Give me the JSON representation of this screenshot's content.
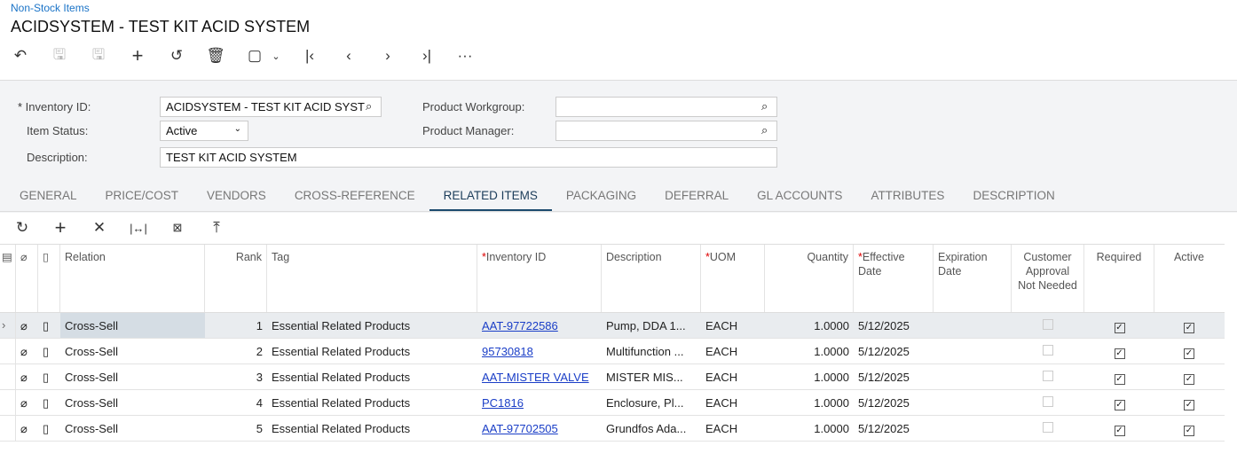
{
  "breadcrumb": "Non-Stock Items",
  "title": "ACIDSYSTEM - TEST KIT ACID SYSTEM",
  "form": {
    "inventory_id_label": "Inventory ID:",
    "inventory_id": "ACIDSYSTEM - TEST KIT ACID SYST",
    "item_status_label": "Item Status:",
    "item_status": "Active",
    "description_label": "Description:",
    "description": "TEST KIT ACID SYSTEM",
    "workgroup_label": "Product Workgroup:",
    "workgroup": "",
    "manager_label": "Product Manager:",
    "manager": ""
  },
  "tabs": [
    "GENERAL",
    "PRICE/COST",
    "VENDORS",
    "CROSS-REFERENCE",
    "RELATED ITEMS",
    "PACKAGING",
    "DEFERRAL",
    "GL ACCOUNTS",
    "ATTRIBUTES",
    "DESCRIPTION"
  ],
  "active_tab": "RELATED ITEMS",
  "columns": {
    "relation": "Relation",
    "rank": "Rank",
    "tag": "Tag",
    "inventory_id": "Inventory ID",
    "description": "Description",
    "uom": "UOM",
    "quantity": "Quantity",
    "effective_date": "Effective Date",
    "expiration_date": "Expiration Date",
    "customer_approval": "Customer Approval Not Needed",
    "required": "Required",
    "active": "Active"
  },
  "rows": [
    {
      "relation": "Cross-Sell",
      "rank": "1",
      "tag": "Essential Related Products",
      "inventory_id": "AAT-97722586",
      "description": "Pump, DDA 1...",
      "uom": "EACH",
      "quantity": "1.0000",
      "effective_date": "5/12/2025",
      "expiration_date": "",
      "customer_approval": false,
      "required": true,
      "active": true
    },
    {
      "relation": "Cross-Sell",
      "rank": "2",
      "tag": "Essential Related Products",
      "inventory_id": "95730818",
      "description": "Multifunction ...",
      "uom": "EACH",
      "quantity": "1.0000",
      "effective_date": "5/12/2025",
      "expiration_date": "",
      "customer_approval": false,
      "required": true,
      "active": true
    },
    {
      "relation": "Cross-Sell",
      "rank": "3",
      "tag": "Essential Related Products",
      "inventory_id": "AAT-MISTER VALVE",
      "description": "MISTER MIS...",
      "uom": "EACH",
      "quantity": "1.0000",
      "effective_date": "5/12/2025",
      "expiration_date": "",
      "customer_approval": false,
      "required": true,
      "active": true
    },
    {
      "relation": "Cross-Sell",
      "rank": "4",
      "tag": "Essential Related Products",
      "inventory_id": "PC1816",
      "description": "Enclosure, Pl...",
      "uom": "EACH",
      "quantity": "1.0000",
      "effective_date": "5/12/2025",
      "expiration_date": "",
      "customer_approval": false,
      "required": true,
      "active": true
    },
    {
      "relation": "Cross-Sell",
      "rank": "5",
      "tag": "Essential Related Products",
      "inventory_id": "AAT-97702505",
      "description": "Grundfos Ada...",
      "uom": "EACH",
      "quantity": "1.0000",
      "effective_date": "5/12/2025",
      "expiration_date": "",
      "customer_approval": false,
      "required": true,
      "active": true
    }
  ]
}
